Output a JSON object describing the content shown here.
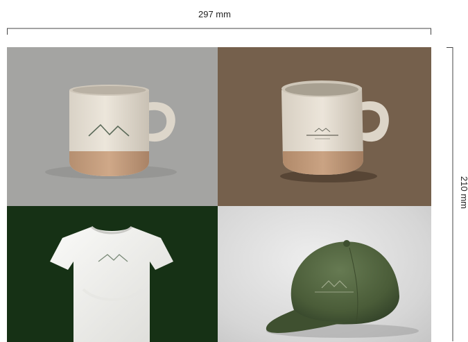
{
  "dimensions": {
    "width_label": "297 mm",
    "height_label": "210 mm"
  },
  "tiles": [
    {
      "product": "mug",
      "background": "#a4a4a2"
    },
    {
      "product": "mug",
      "background": "#75604c"
    },
    {
      "product": "t-shirt",
      "background": "#163115"
    },
    {
      "product": "cap",
      "background": "#d9d9d9"
    }
  ],
  "colors": {
    "mug_body": "#e6dfd3",
    "mug_base": "#c49c7c",
    "shirt": "#f2f2f0",
    "cap": "#4b5e3a"
  }
}
